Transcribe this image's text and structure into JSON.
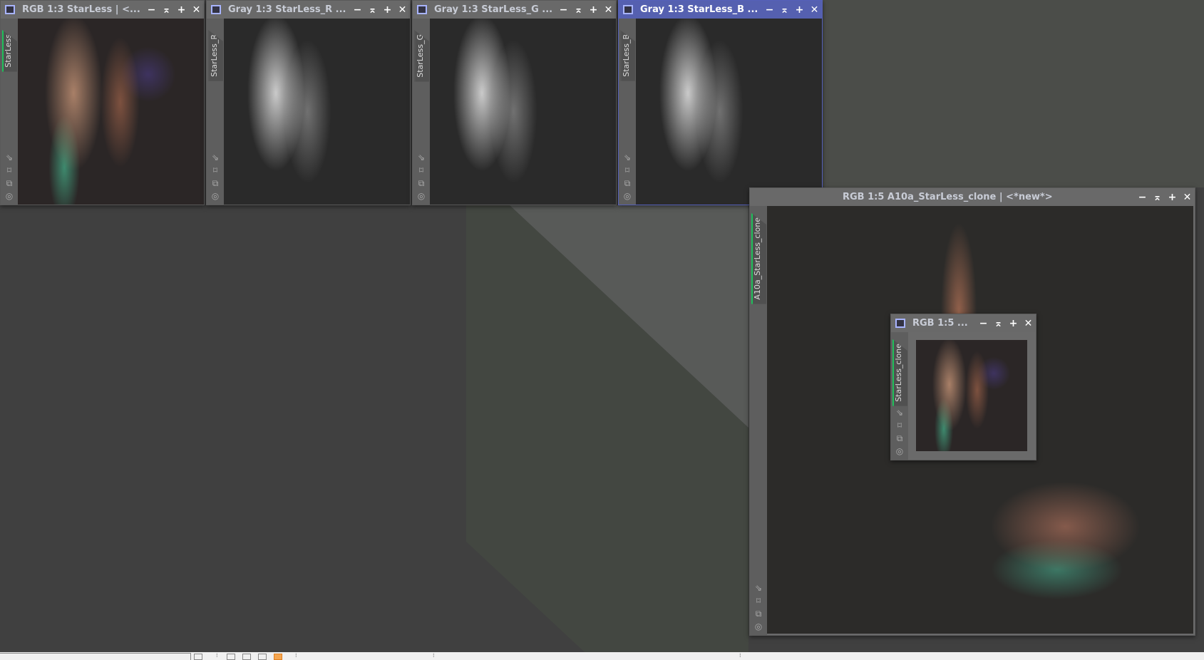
{
  "windows": [
    {
      "title": "RGB 1:3 StarLess | <...",
      "tab": "StarLess",
      "kind": "rgb",
      "active": false
    },
    {
      "title": "Gray 1:3 StarLess_R ...",
      "tab": "StarLess_R",
      "kind": "gray",
      "active": false
    },
    {
      "title": "Gray 1:3 StarLess_G ...",
      "tab": "StarLess_G",
      "kind": "gray",
      "active": false
    },
    {
      "title": "Gray 1:3 StarLess_B ...",
      "tab": "StarLess_B",
      "kind": "gray",
      "active": true
    }
  ],
  "big_window": {
    "title": "RGB 1:5 A10a_StarLess_clone | <*new*>",
    "tab": "A10a_StarLess_clone"
  },
  "small_window": {
    "title": "RGB 1:5 ...",
    "tab": "StarLess_clone"
  },
  "buttons": {
    "minimize": "−",
    "shade": "⌅",
    "maximize": "+",
    "close": "✕"
  },
  "tools": [
    "⇘",
    "⌑",
    "⧉",
    "◎"
  ],
  "colors": {
    "active_title": "#5560b0",
    "tab_accent": "#1fbf5a",
    "status_highlight": "#f5a650"
  }
}
